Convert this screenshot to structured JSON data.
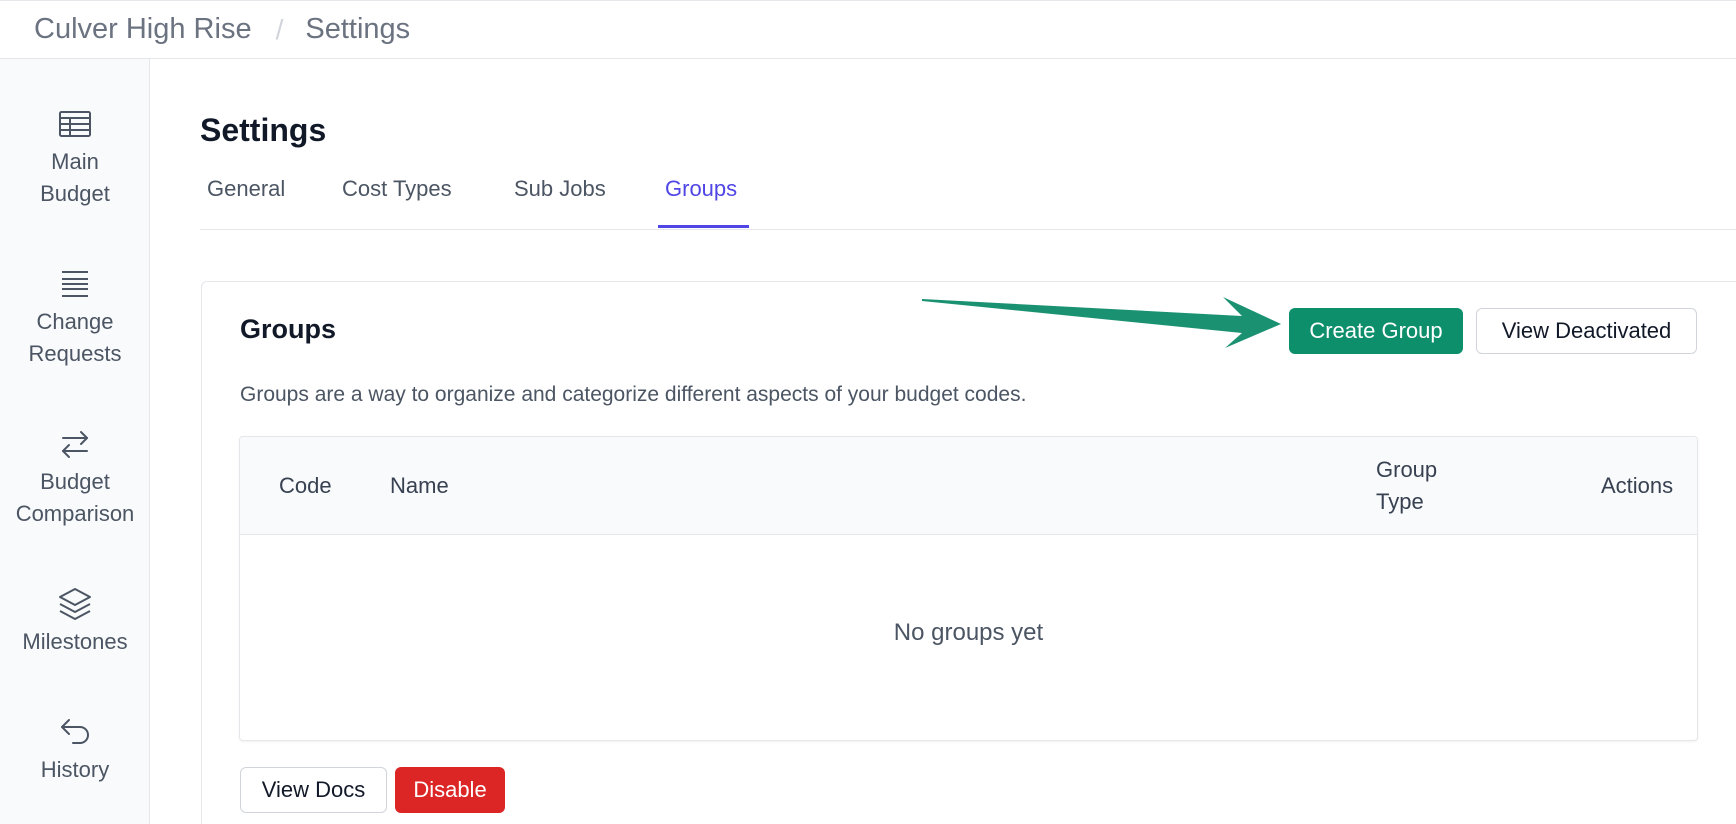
{
  "breadcrumb": {
    "project": "Culver High Rise",
    "separator": "/",
    "page": "Settings"
  },
  "sidebar": {
    "items": [
      {
        "label": "Main\nBudget",
        "icon": "table-icon"
      },
      {
        "label": "Change\nRequests",
        "icon": "list-icon"
      },
      {
        "label": "Budget\nComparison",
        "icon": "arrows-left-right-icon"
      },
      {
        "label": "Milestones",
        "icon": "layers-icon"
      },
      {
        "label": "History",
        "icon": "undo-arrow-icon"
      }
    ]
  },
  "page": {
    "title": "Settings"
  },
  "tabs": [
    {
      "label": "General",
      "active": false
    },
    {
      "label": "Cost Types",
      "active": false
    },
    {
      "label": "Sub Jobs",
      "active": false
    },
    {
      "label": "Groups",
      "active": true
    }
  ],
  "groups": {
    "title": "Groups",
    "description": "Groups are a way to organize and categorize different aspects of your budget codes.",
    "create_label": "Create Group",
    "view_deactivated_label": "View Deactivated",
    "table": {
      "headers": {
        "code": "Code",
        "name": "Name",
        "group_type": "Group\nType",
        "actions": "Actions"
      },
      "empty_text": "No groups yet"
    },
    "view_docs_label": "View Docs",
    "disable_label": "Disable"
  },
  "colors": {
    "accent": "#4f46e5",
    "primary_button": "#0e8f6c",
    "danger_button": "#dc2626",
    "annotation_arrow": "#1a9272"
  }
}
